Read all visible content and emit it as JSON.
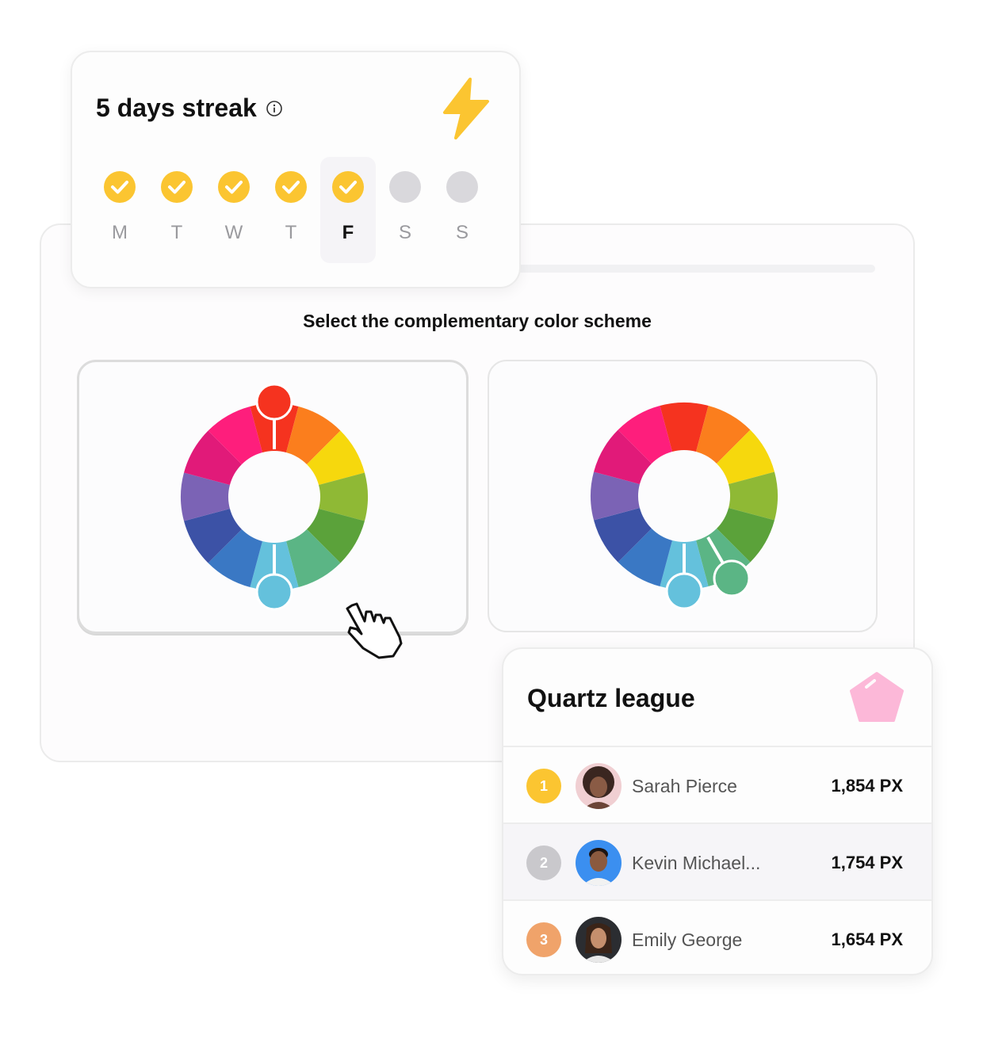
{
  "streak": {
    "title": "5 days streak",
    "days": [
      {
        "label": "M",
        "done": true
      },
      {
        "label": "T",
        "done": true
      },
      {
        "label": "W",
        "done": true
      },
      {
        "label": "T",
        "done": true
      },
      {
        "label": "F",
        "done": true,
        "today": true
      },
      {
        "label": "S",
        "done": false
      },
      {
        "label": "S",
        "done": false
      }
    ],
    "accent": "#fbc531"
  },
  "quiz": {
    "question": "Select the complementary color scheme",
    "wheel_colors": [
      "#f5331f",
      "#fb7e1d",
      "#f6d80d",
      "#8fb935",
      "#5ba23a",
      "#5bb585",
      "#64c1dc",
      "#3a78c4",
      "#3c52a6",
      "#7b63b5",
      "#e11a79",
      "#fe1e7c"
    ],
    "options": [
      {
        "id": "a",
        "selected": true,
        "markers": [
          "#f5331f",
          "#64c1dc"
        ]
      },
      {
        "id": "b",
        "selected": false,
        "markers": [
          "#64c1dc",
          "#5bb585"
        ]
      }
    ]
  },
  "league": {
    "title": "Quartz league",
    "rows": [
      {
        "rank": "1",
        "rank_color": "#fbc531",
        "name": "Sarah Pierce",
        "points": "1,854 PX"
      },
      {
        "rank": "2",
        "rank_color": "#c9c8cc",
        "name": "Kevin Michael...",
        "points": "1,754 PX"
      },
      {
        "rank": "3",
        "rank_color": "#f0a36a",
        "name": "Emily George",
        "points": "1,654 PX"
      }
    ]
  }
}
